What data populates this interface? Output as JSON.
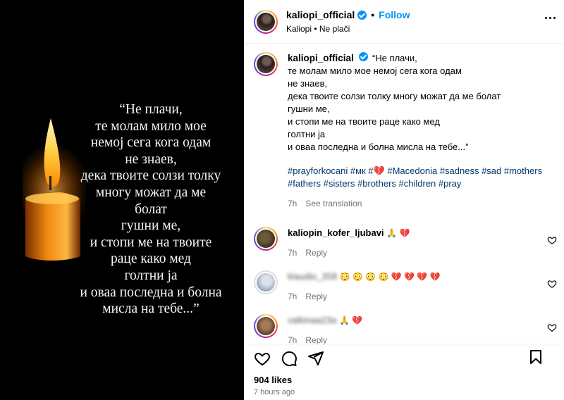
{
  "media": {
    "quote": "“Не плачи,\nте молам мило мое\nнемој сега кога одам\nне знаев,\nдека твоите солзи толку\nмногу можат да ме\nболат\nгушни ме,\nи стопи ме на твоите\nраце како мед\nголтни ја\nи оваа последна и болна\nмисла на тебе...”"
  },
  "header": {
    "username": "kaliopi_official",
    "follow_label": "Follow",
    "audio": "Kaliopi • Ne plači"
  },
  "caption": {
    "username": "kaliopi_official",
    "text": "“Не плачи,\nте молам мило мое немој сега кога одам\nне знаев,\nдека твоите солзи толку многу можат да ме болат\nгушни ме,\nи стопи ме на твоите раце како мед\nголтни ја\nи оваа последна и болна мисла на тебе...”",
    "hashtags": "#prayforkocani #мк #💔 #Macedonia #sadness #sad #mothers\n#fathers #sisters #brothers #children #pray",
    "time": "7h",
    "see_translation": "See translation"
  },
  "comments": [
    {
      "username": "kaliopin_kofer_ljubavi",
      "text": "🙏 💔",
      "time": "7h",
      "reply": "Reply",
      "blurred": false
    },
    {
      "username": "klaudio_358",
      "text": "😳 😳 😳 😳 💔 💔 💔 💔",
      "time": "7h",
      "reply": "Reply",
      "blurred": true
    },
    {
      "username": "valkinaa23a",
      "text": "🙏 💔",
      "time": "7h",
      "reply": "Reply",
      "blurred": true
    }
  ],
  "footer": {
    "likes": "904 likes",
    "ago": "7 hours ago"
  },
  "colors": {
    "link_blue": "#0095f6",
    "hashtag_blue": "#00376b",
    "muted": "#737373"
  }
}
